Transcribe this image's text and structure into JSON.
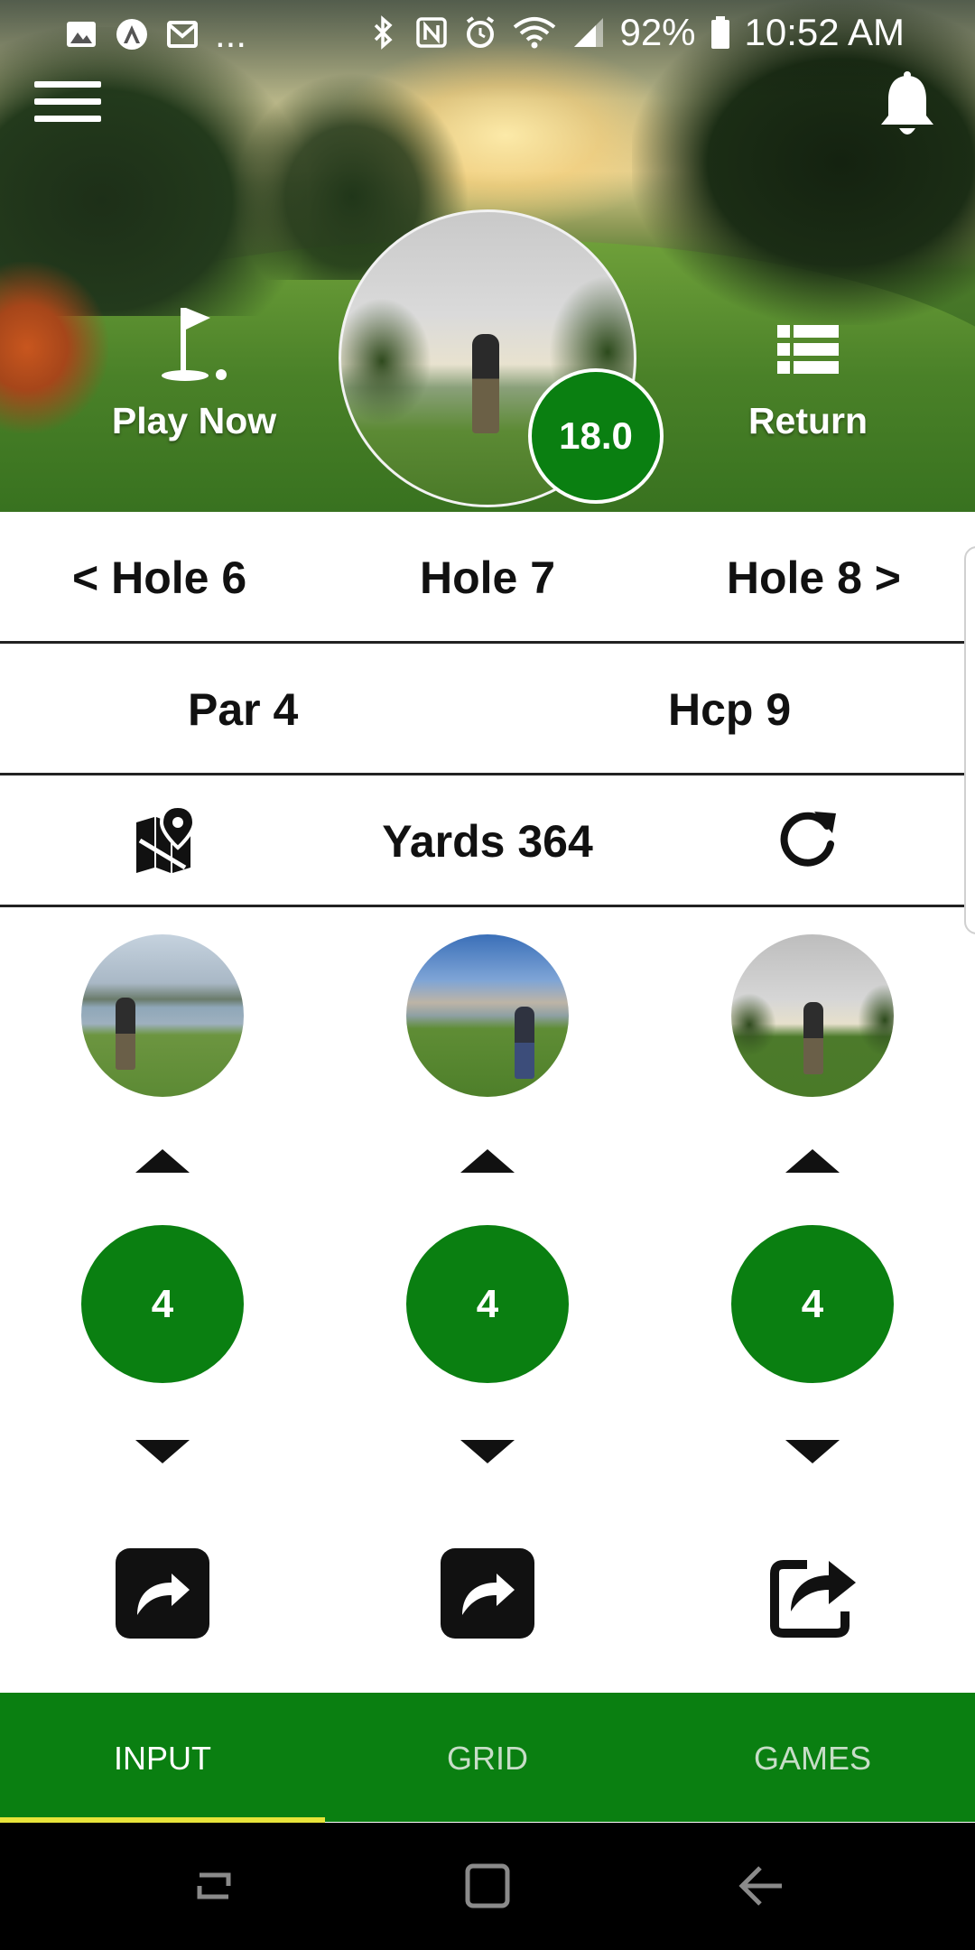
{
  "status_bar": {
    "battery": "92%",
    "time": "10:52 AM",
    "more_indicator": "...",
    "left_icons": [
      "gallery-icon",
      "app-a-icon",
      "mail-icon"
    ],
    "right_icons": [
      "bluetooth-icon",
      "nfc-icon",
      "alarm-icon",
      "wifi-icon",
      "signal-icon",
      "battery-icon"
    ]
  },
  "header": {
    "play_now_label": "Play Now",
    "return_label": "Return",
    "handicap": "18.0"
  },
  "hole_nav": {
    "prev": "< Hole 6",
    "current": "Hole 7",
    "next": "Hole 8 >"
  },
  "hole_info": {
    "par": "Par 4",
    "hcp": "Hcp 9",
    "yards": "Yards 364"
  },
  "players": [
    {
      "score": "4"
    },
    {
      "score": "4"
    },
    {
      "score": "4"
    }
  ],
  "tabs": {
    "input": "INPUT",
    "grid": "GRID",
    "games": "GAMES",
    "active": "INPUT"
  },
  "colors": {
    "brand_green": "#0a7f11",
    "tab_indicator": "#e8e43a",
    "text": "#111111"
  }
}
